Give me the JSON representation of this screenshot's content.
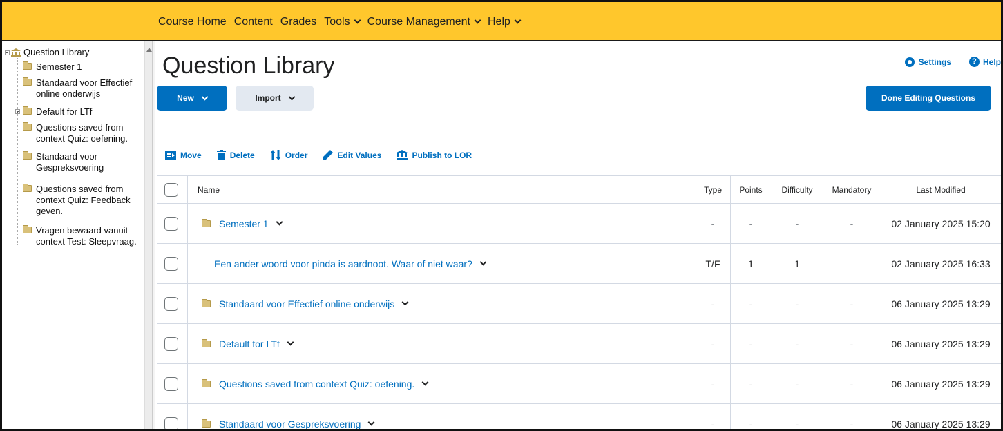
{
  "topnav": {
    "items": [
      {
        "label": "Course Home",
        "has_menu": false
      },
      {
        "label": "Content",
        "has_menu": false
      },
      {
        "label": "Grades",
        "has_menu": false
      },
      {
        "label": "Tools",
        "has_menu": true
      },
      {
        "label": "Course Management",
        "has_menu": true
      },
      {
        "label": "Help",
        "has_menu": true
      }
    ]
  },
  "tree": {
    "root_label": "Question Library",
    "items": [
      {
        "label": "Semester 1",
        "icon": "folder-icon"
      },
      {
        "label": "Standaard voor Effectief online onderwijs",
        "icon": "folder-icon"
      },
      {
        "label": "Default for LTf",
        "icon": "folder-icon",
        "expandable": true
      },
      {
        "label": "Questions saved from context Quiz: oefening.",
        "icon": "folder-icon"
      },
      {
        "label": "Standaard voor Gespreksvoering",
        "icon": "folder-icon"
      },
      {
        "label": "Questions saved from context Quiz: Feedback geven.",
        "icon": "folder-icon"
      },
      {
        "label": "Vragen bewaard vanuit context Test: Sleepvraag.",
        "icon": "folder-icon"
      }
    ]
  },
  "main": {
    "title": "Question Library",
    "settings_label": "Settings",
    "help_label": "Help",
    "new_label": "New",
    "import_label": "Import",
    "done_label": "Done Editing Questions",
    "toolbar": {
      "move": "Move",
      "delete": "Delete",
      "order": "Order",
      "edit_values": "Edit Values",
      "publish": "Publish to LOR"
    },
    "columns": {
      "name": "Name",
      "type": "Type",
      "points": "Points",
      "difficulty": "Difficulty",
      "mandatory": "Mandatory",
      "last_modified": "Last Modified"
    },
    "rows": [
      {
        "name": "Semester 1",
        "is_folder": true,
        "type": "-",
        "points": "-",
        "difficulty": "-",
        "mandatory": "-",
        "last_modified": "02 January 2025 15:20"
      },
      {
        "name": "Een ander woord voor pinda is aardnoot. Waar of niet waar?",
        "is_folder": false,
        "type": "T/F",
        "points": "1",
        "difficulty": "1",
        "mandatory": "",
        "last_modified": "02 January 2025 16:33"
      },
      {
        "name": "Standaard voor Effectief online onderwijs",
        "is_folder": true,
        "type": "-",
        "points": "-",
        "difficulty": "-",
        "mandatory": "-",
        "last_modified": "06 January 2025 13:29"
      },
      {
        "name": "Default for LTf",
        "is_folder": true,
        "type": "-",
        "points": "-",
        "difficulty": "-",
        "mandatory": "-",
        "last_modified": "06 January 2025 13:29"
      },
      {
        "name": "Questions saved from context Quiz: oefening.",
        "is_folder": true,
        "type": "-",
        "points": "-",
        "difficulty": "-",
        "mandatory": "-",
        "last_modified": "06 January 2025 13:29"
      },
      {
        "name": "Standaard voor Gespreksvoering",
        "is_folder": true,
        "type": "-",
        "points": "-",
        "difficulty": "-",
        "mandatory": "-",
        "last_modified": "06 January 2025 13:29"
      }
    ]
  },
  "colors": {
    "nav_bg": "#ffc72c",
    "link": "#006fbf",
    "primary_button": "#006fbf",
    "secondary_button": "#e3e9f1"
  }
}
